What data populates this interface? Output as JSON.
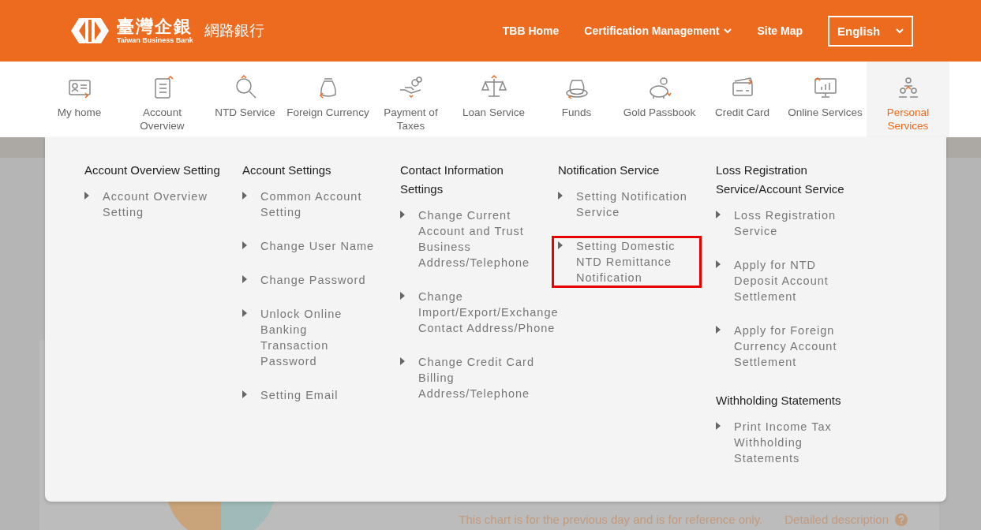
{
  "header": {
    "logo_chinese": "臺灣企銀",
    "logo_english": "Taiwan Business Bank",
    "site_name": "網路銀行",
    "links": [
      {
        "label": "TBB Home",
        "dropdown": false
      },
      {
        "label": "Certification Management",
        "dropdown": true
      },
      {
        "label": "Site Map",
        "dropdown": false
      }
    ],
    "language": "English"
  },
  "nav": [
    {
      "label": "My home",
      "selected": false
    },
    {
      "label": "Account Overview",
      "selected": false
    },
    {
      "label": "NTD Service",
      "selected": false
    },
    {
      "label": "Foreign Currency",
      "selected": false
    },
    {
      "label": "Payment of Taxes",
      "selected": false
    },
    {
      "label": "Loan Service",
      "selected": false
    },
    {
      "label": "Funds",
      "selected": false
    },
    {
      "label": "Gold Passbook",
      "selected": false
    },
    {
      "label": "Credit Card",
      "selected": false
    },
    {
      "label": "Online Services",
      "selected": false
    },
    {
      "label": "Personal Services",
      "selected": true
    }
  ],
  "menu": {
    "columns": [
      {
        "groups": [
          {
            "title": "Account Overview Setting",
            "items": [
              {
                "label": "Account Overview Setting",
                "highlighted": false
              }
            ]
          }
        ]
      },
      {
        "groups": [
          {
            "title": "Account Settings",
            "items": [
              {
                "label": "Common Account Setting",
                "highlighted": false
              },
              {
                "label": "Change User Name",
                "highlighted": false
              },
              {
                "label": "Change Password",
                "highlighted": false
              },
              {
                "label": "Unlock Online Banking Transaction Password",
                "highlighted": false
              },
              {
                "label": "Setting Email",
                "highlighted": false
              }
            ]
          }
        ]
      },
      {
        "groups": [
          {
            "title": "Contact Information Settings",
            "items": [
              {
                "label": "Change Current Account and Trust Business Address/Telephone",
                "highlighted": false
              },
              {
                "label": "Change Import/Export/Exchange Contact Address/Phone",
                "highlighted": false
              },
              {
                "label": "Change Credit Card Billing Address/Telephone",
                "highlighted": false
              }
            ]
          }
        ]
      },
      {
        "groups": [
          {
            "title": "Notification Service",
            "items": [
              {
                "label": "Setting Notification Service",
                "highlighted": false
              },
              {
                "label": "Setting Domestic NTD Remittance Notification",
                "highlighted": true
              }
            ]
          }
        ]
      },
      {
        "groups": [
          {
            "title": "Loss Registration Service/Account Service",
            "items": [
              {
                "label": "Loss Registration Service",
                "highlighted": false
              },
              {
                "label": "Apply for NTD Deposit Account Settlement",
                "highlighted": false
              },
              {
                "label": "Apply for Foreign Currency Account Settlement",
                "highlighted": false
              }
            ]
          },
          {
            "title": "Withholding Statements",
            "items": [
              {
                "label": "Print Income Tax Withholding Statements",
                "highlighted": false
              }
            ]
          }
        ]
      }
    ]
  },
  "chart_note": "This chart is for the previous day and is for reference only.",
  "detail_link": "Detailed description"
}
